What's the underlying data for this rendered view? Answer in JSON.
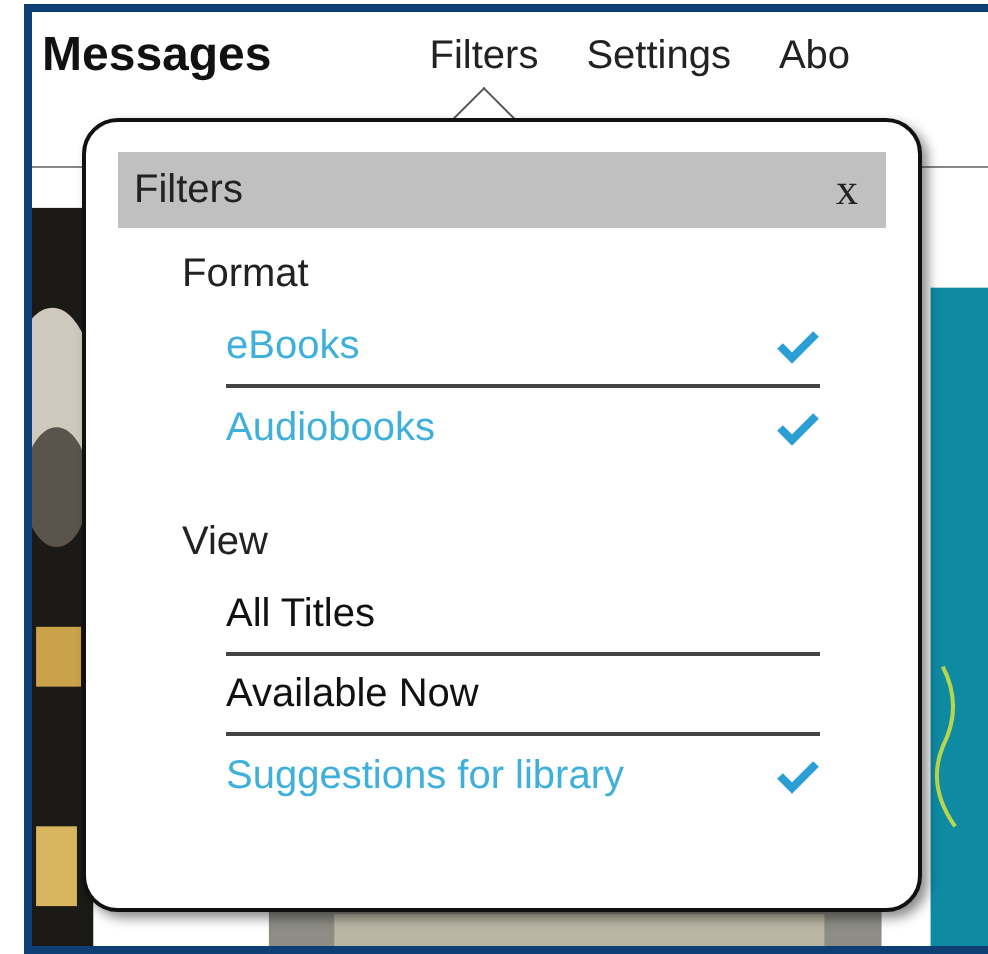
{
  "header": {
    "title": "Messages",
    "nav": [
      {
        "label": "Filters",
        "selected": true
      },
      {
        "label": "Settings",
        "selected": false
      },
      {
        "label": "Abo",
        "selected": false
      }
    ]
  },
  "popup": {
    "title": "Filters",
    "close": "x",
    "sections": [
      {
        "heading": "Format",
        "options": [
          {
            "label": "eBooks",
            "checked": true
          },
          {
            "label": "Audiobooks",
            "checked": true
          }
        ]
      },
      {
        "heading": "View",
        "options": [
          {
            "label": "All Titles",
            "checked": false
          },
          {
            "label": "Available Now",
            "checked": false
          },
          {
            "label": "Suggestions for library",
            "checked": true
          }
        ]
      }
    ]
  }
}
